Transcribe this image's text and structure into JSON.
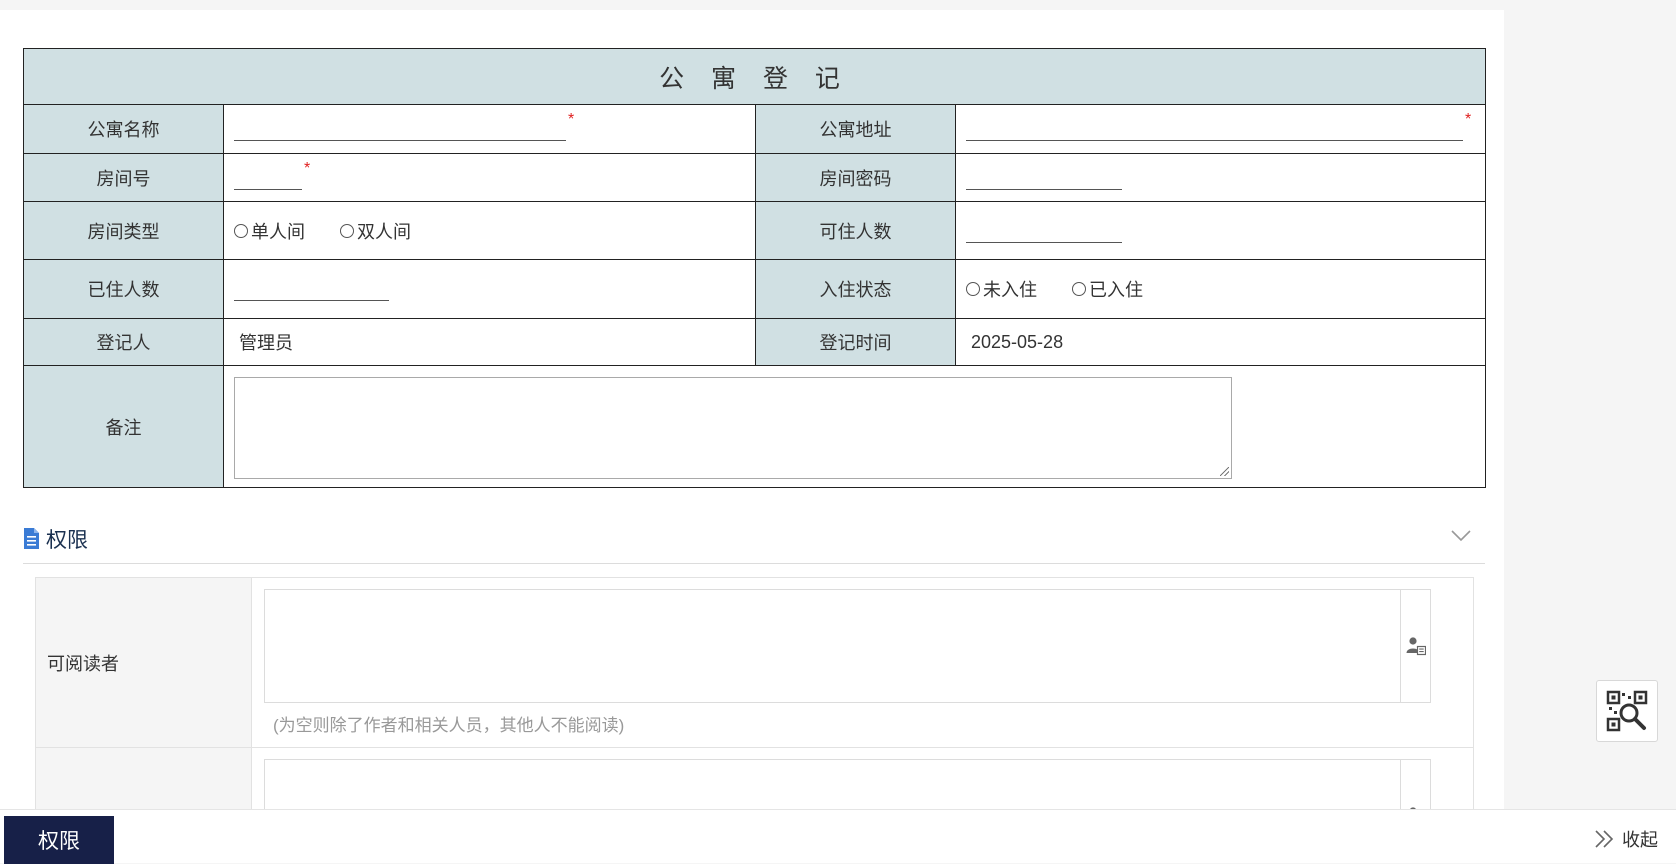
{
  "form": {
    "title": "公 寓 登 记",
    "fields": {
      "apartment_name": {
        "label": "公寓名称",
        "required_mark": "*"
      },
      "apartment_address": {
        "label": "公寓地址",
        "required_mark": "*"
      },
      "room_number": {
        "label": "房间号",
        "required_mark": "*"
      },
      "room_password": {
        "label": "房间密码"
      },
      "room_type": {
        "label": "房间类型",
        "options": [
          "单人间",
          "双人间"
        ]
      },
      "capacity": {
        "label": "可住人数"
      },
      "occupied": {
        "label": "已住人数"
      },
      "status": {
        "label": "入住状态",
        "options": [
          "未入住",
          "已入住"
        ]
      },
      "registrant": {
        "label": "登记人",
        "value": "管理员"
      },
      "register_time": {
        "label": "登记时间",
        "value": "2025-05-28"
      },
      "remark": {
        "label": "备注"
      }
    }
  },
  "permissions": {
    "title": "权限",
    "icon": "document-icon",
    "readers": {
      "label": "可阅读者",
      "hint": "(为空则除了作者和相关人员，其他人不能阅读)",
      "picker_icon": "user-picker-icon"
    }
  },
  "floating": {
    "qr_icon": "qr-scan-icon"
  },
  "bottom_bar": {
    "tab_label": "权限",
    "collapse_label": "收起"
  },
  "colors": {
    "label_bg": "#d0e0e3",
    "required": "#e02020",
    "bottom_tab_bg": "#172048",
    "section_title": "#1a3050",
    "doc_icon": "#3a7bd5"
  }
}
